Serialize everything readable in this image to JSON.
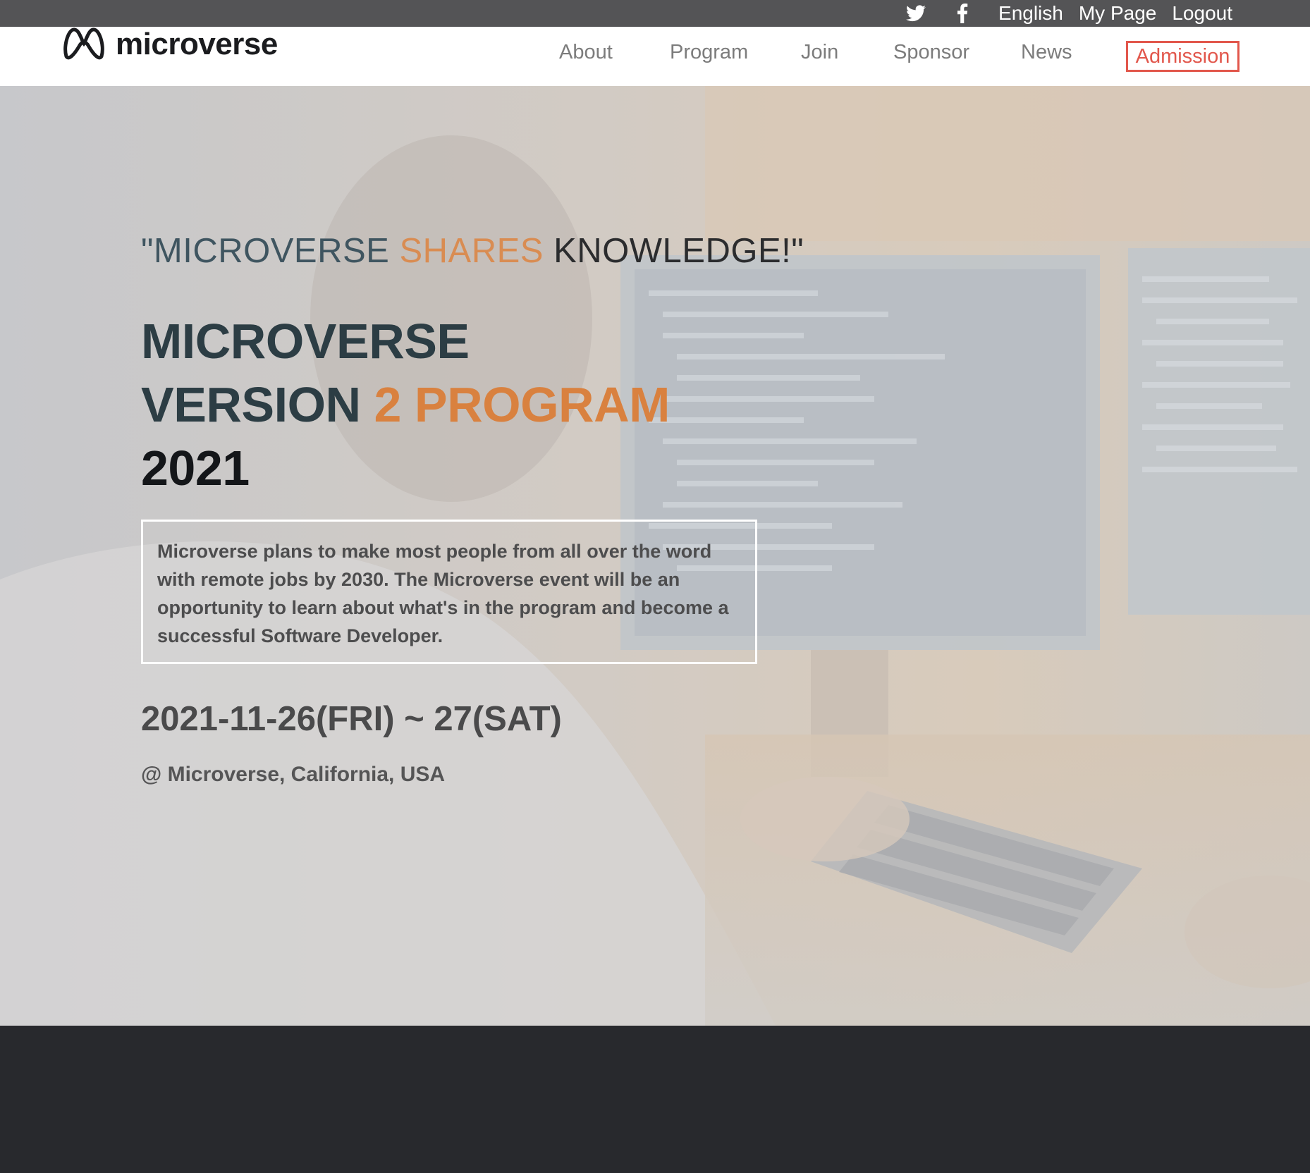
{
  "top_bar": {
    "icons": [
      "twitter-icon",
      "facebook-icon"
    ],
    "language": "English",
    "my_page": "My Page",
    "logout": "Logout"
  },
  "header": {
    "logo_text": "microverse",
    "nav": [
      "About",
      "Program",
      "Join",
      "Sponsor",
      "News"
    ],
    "cta": "Admission"
  },
  "hero": {
    "tagline_part1": "\"MICROVERSE ",
    "tagline_part2": "SHARES ",
    "tagline_part3": "KNOWLEDGE!\"",
    "title_line1": "MICROVERSE",
    "title_line2_part1": "VERSION ",
    "title_line2_part2": "2 PROGRAM",
    "title_line3": "2021",
    "description": "Microverse plans to make most people from all over the word with remote jobs by 2030. The Microverse event will be an opportunity to learn about what's in the program and become a successful Software Developer.",
    "date": "2021-11-26(FRI) ~ 27(SAT)",
    "location": "@ Microverse, California, USA"
  },
  "colors": {
    "top_bar": "#545456",
    "accent_red": "#e2574c",
    "accent_orange": "#d9813f",
    "dark_band": "#28292d"
  }
}
